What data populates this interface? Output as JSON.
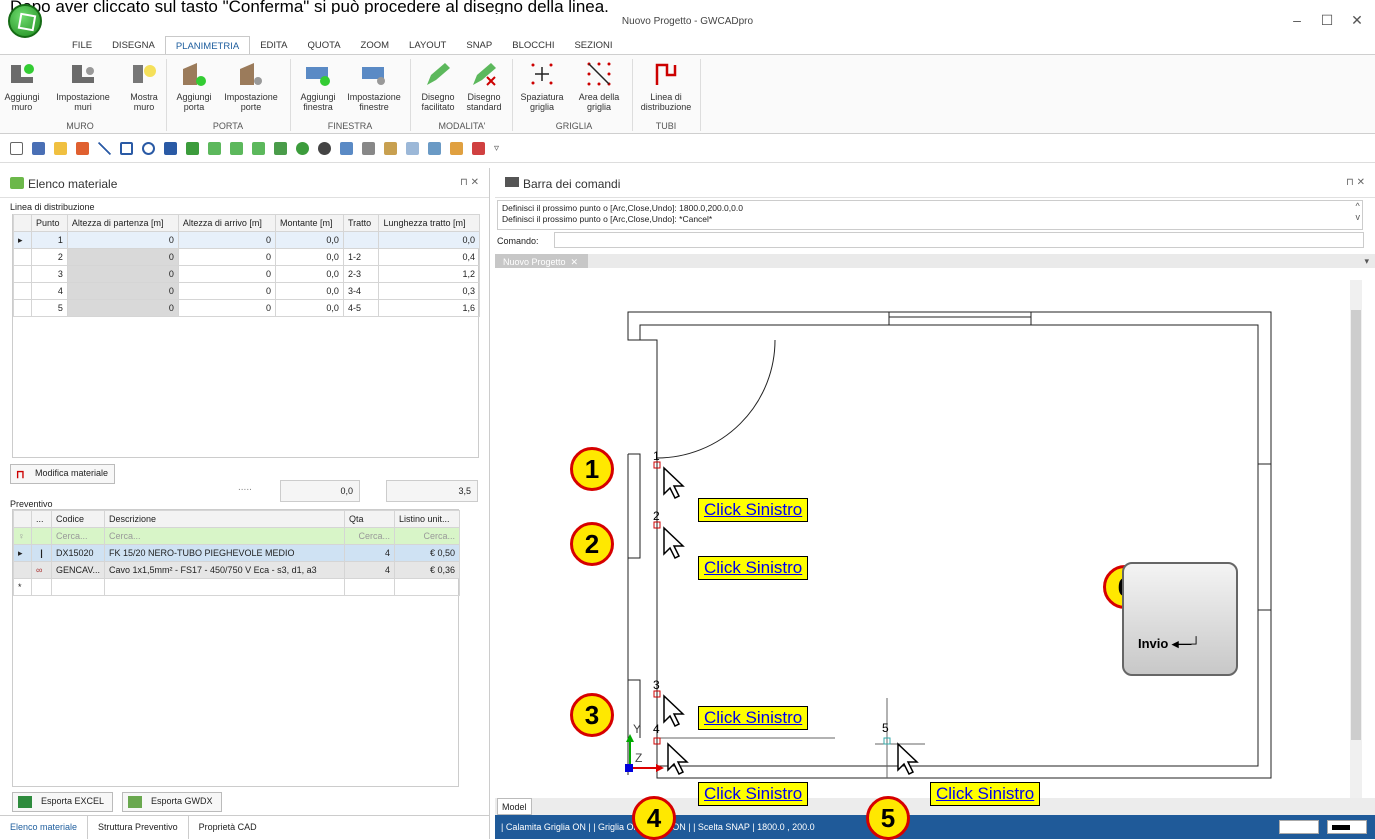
{
  "caption": "Dopo aver cliccato sul tasto \"Conferma\" si può procedere al disegno della linea.",
  "window": {
    "title": "Nuovo Progetto - GWCADpro",
    "minimize": "–",
    "maximize": "☐",
    "close": "✕"
  },
  "menu": [
    "FILE",
    "DISEGNA",
    "PLANIMETRIA",
    "EDITA",
    "QUOTA",
    "ZOOM",
    "LAYOUT",
    "SNAP",
    "BLOCCHI",
    "SEZIONI"
  ],
  "ribbon": {
    "buttons": [
      {
        "l1": "Aggiungi",
        "l2": "muro",
        "c": "#5a5a5a"
      },
      {
        "l1": "Impostazione",
        "l2": "muri",
        "c": "#5a5a5a"
      },
      {
        "l1": "Mostra",
        "l2": "muro",
        "c": "#888"
      },
      {
        "l1": "Aggiungi",
        "l2": "porta",
        "c": "#8a6b4a"
      },
      {
        "l1": "Impostazione",
        "l2": "porte",
        "c": "#8a6b4a"
      },
      {
        "l1": "Aggiungi",
        "l2": "finestra",
        "c": "#4a7ab5"
      },
      {
        "l1": "Impostazione",
        "l2": "finestre",
        "c": "#4a7ab5"
      },
      {
        "l1": "Disegno",
        "l2": "facilitato",
        "c": "#5cb85c"
      },
      {
        "l1": "Disegno",
        "l2": "standard",
        "c": "#5cb85c"
      },
      {
        "l1": "Spaziatura",
        "l2": "griglia",
        "c": "#222"
      },
      {
        "l1": "Area della",
        "l2": "griglia",
        "c": "#c00"
      },
      {
        "l1": "Linea di",
        "l2": "distribuzione",
        "c": "#c00"
      }
    ],
    "groups": [
      "MURO",
      "PORTA",
      "FINESTRA",
      "MODALITA'",
      "GRIGLIA",
      "TUBI"
    ]
  },
  "materiale": {
    "title": "Elenco materiale",
    "pin": "⊓ ✕",
    "linea_label": "Linea di distribuzione",
    "columns": [
      "Punto",
      "Altezza di partenza [m]",
      "Altezza di arrivo [m]",
      "Montante [m]",
      "Tratto",
      "Lunghezza tratto [m]"
    ],
    "rows": [
      [
        "1",
        "0",
        "0",
        "0,0",
        "",
        "0,0"
      ],
      [
        "2",
        "0",
        "0",
        "0,0",
        "1-2",
        "0,4"
      ],
      [
        "3",
        "0",
        "0",
        "0,0",
        "2-3",
        "1,2"
      ],
      [
        "4",
        "0",
        "0",
        "0,0",
        "3-4",
        "0,3"
      ],
      [
        "5",
        "0",
        "0",
        "0,0",
        "4-5",
        "1,6"
      ]
    ],
    "total_montante": "0,0",
    "total_lunghezza": "3,5",
    "modifica_btn": "Modifica materiale",
    "dots": ".....",
    "preventivo_label": "Preventivo",
    "prev_columns": [
      "...",
      "Codice",
      "Descrizione",
      "Qta",
      "Listino unit..."
    ],
    "search": [
      "Cerca...",
      "Cerca...",
      "Cerca...",
      "Cerca..."
    ],
    "prev_rows": [
      [
        "DX15020",
        "FK 15/20 NERO-TUBO PIEGHEVOLE MEDIO",
        "4",
        "€ 0,50"
      ],
      [
        "GENCAV...",
        "Cavo 1x1,5mm² - FS17 - 450/750 V Eca - s3, d1, a3",
        "4",
        "€ 0,36"
      ]
    ],
    "export_excel": "Esporta EXCEL",
    "export_gwdx": "Esporta GWDX",
    "bottom_tabs": [
      "Elenco materiale",
      "Struttura Preventivo",
      "Proprietà CAD"
    ]
  },
  "comandi": {
    "title": "Barra dei comandi",
    "lines": [
      "Definisci il prossimo punto o [Arc,Close,Undo]: 1800.0,200.0,0.0",
      "Definisci il prossimo punto o [Arc,Close,Undo]: *Cancel*"
    ],
    "prompt": "Comando:"
  },
  "doc_tab": "Nuovo Progetto",
  "model_tab": "Model",
  "status": "| Calamita Griglia ON |  | Griglia ON |  | Orto ON |  | Scelta SNAP |   1800.0 , 200.0",
  "points": [
    "1",
    "2",
    "3",
    "4",
    "5"
  ],
  "click_label": "Click Sinistro",
  "invio": "Invio",
  "steps": [
    "1",
    "2",
    "3",
    "4",
    "5",
    "6"
  ],
  "axis": {
    "y": "Y",
    "z": "Z"
  }
}
